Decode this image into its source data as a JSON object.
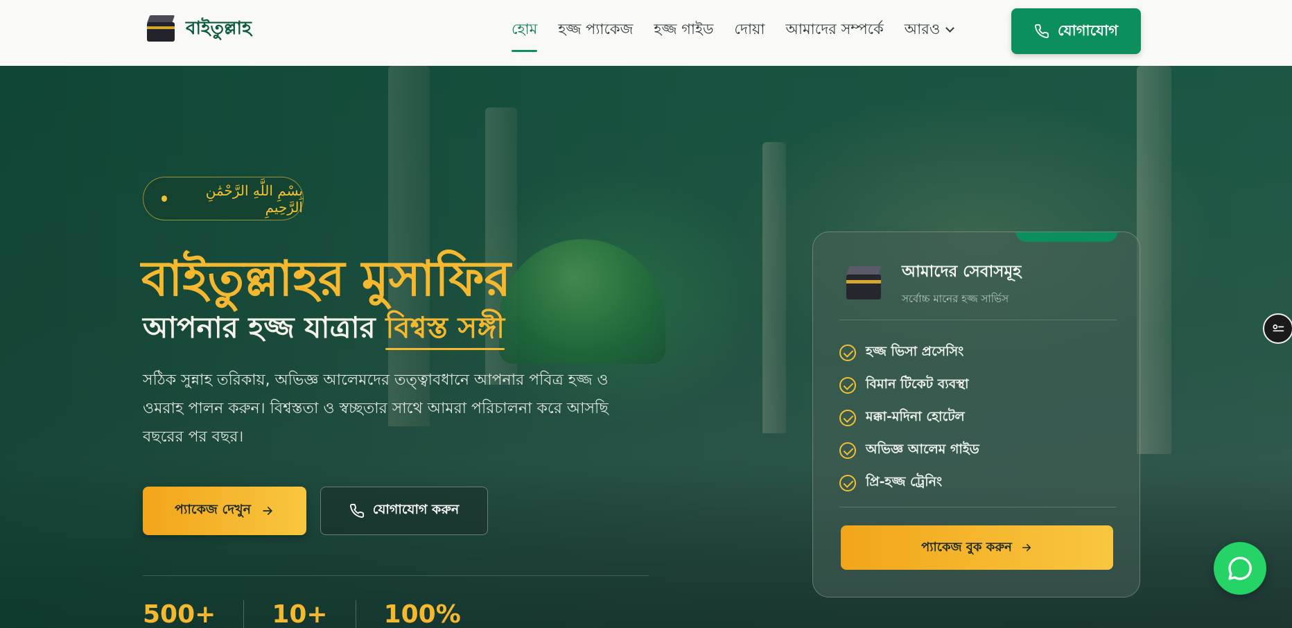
{
  "brand": {
    "name": "বাইতুল্লাহ",
    "logo_icon": "kaaba-icon"
  },
  "nav": {
    "links": [
      {
        "label": "হোম",
        "active": true
      },
      {
        "label": "হজ্জ প্যাকেজ",
        "active": false
      },
      {
        "label": "হজ্জ গাইড",
        "active": false
      },
      {
        "label": "দোয়া",
        "active": false
      },
      {
        "label": "আমাদের সম্পর্কে",
        "active": false
      }
    ],
    "more_label": "আরও",
    "cta_label": "যোগাযোগ",
    "cta_icon": "phone-icon"
  },
  "hero": {
    "bismillah": "بِسْمِ اللَّهِ الرَّحْمَٰنِ الرَّحِيمِ",
    "title": "বাইতুল্লাহর মুসাফির",
    "subtitle_prefix": "আপনার হজ্জ যাত্রার ",
    "subtitle_highlight": "বিশ্বস্ত সঙ্গী",
    "description": "সঠিক সুন্নাহ তরিকায়, অভিজ্ঞ আলেমদের তত্ত্বাবধানে আপনার পবিত্র হজ্জ ও ওমরাহ পালন করুন। বিশ্বস্ততা ও স্বচ্ছতার সাথে আমরা পরিচালনা করে আসছি বছরের পর বছর।",
    "primary_button": "প্যাকেজ দেখুন",
    "secondary_button": "যোগাযোগ করুন",
    "stats": [
      "500+",
      "10+",
      "100%"
    ]
  },
  "card": {
    "title": "আমাদের সেবাসমূহ",
    "subtitle": "সর্বোচ্চ মানের হজ্জ সার্ভিস",
    "services": [
      "হজ্জ ভিসা প্রসেসিং",
      "বিমান টিকেট ব্যবস্থা",
      "মক্কা-মদিনা হোটেল",
      "অভিজ্ঞ আলেম গাইড",
      "প্রি-হজ্জ ট্রেনিং"
    ],
    "button": "প্যাকেজ বুক করুন"
  },
  "colors": {
    "primary_green": "#0b8f5c",
    "gold": "#f5b82e",
    "whatsapp": "#25d366"
  }
}
